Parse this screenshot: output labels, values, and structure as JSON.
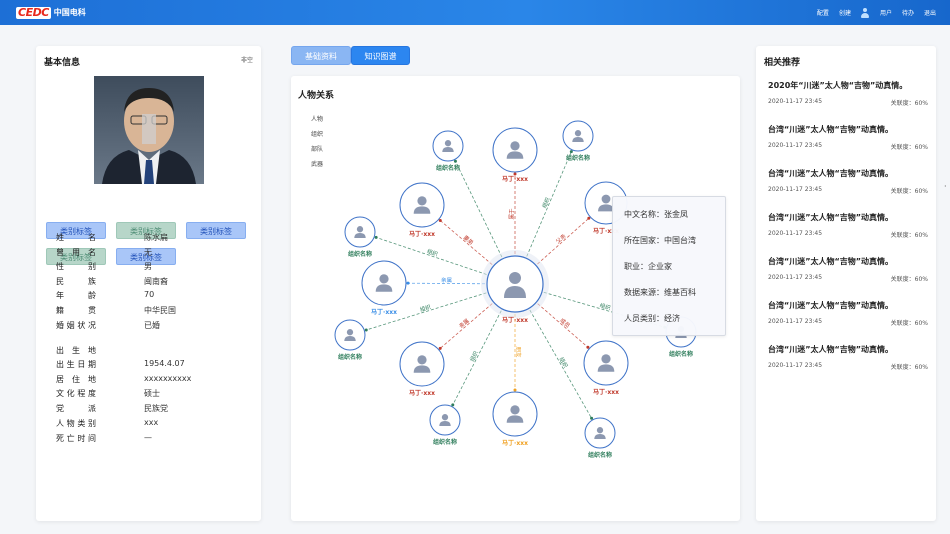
{
  "header": {
    "logo_mark": "CEDC",
    "logo_text": "中国电科",
    "nav": [
      "配置",
      "创建",
      "用户",
      "待办",
      "退出"
    ]
  },
  "left": {
    "title": "基本信息",
    "extra": "非空",
    "tags": [
      {
        "label": "类别标签",
        "style": "blue"
      },
      {
        "label": "类别标签",
        "style": "green"
      },
      {
        "label": "类别标签",
        "style": "blue"
      },
      {
        "label": "类别标签",
        "style": "green"
      },
      {
        "label": "类别标签",
        "style": "blue"
      }
    ],
    "info": [
      {
        "k": "姓名",
        "v": "陈水扁"
      },
      {
        "k": "曾用名",
        "v": "无"
      },
      {
        "k": "性别",
        "v": "男"
      },
      {
        "k": "民族",
        "v": "闽南裔"
      },
      {
        "k": "年龄",
        "v": "70"
      },
      {
        "k": "籍贯",
        "v": "中华民国"
      },
      {
        "k": "婚姻状况",
        "v": "已婚"
      },
      {
        "k": "出生地",
        "v": ""
      },
      {
        "k": "出生日期",
        "v": "1954.4.07"
      },
      {
        "k": "居住地",
        "v": "xxxxxxxxxx"
      },
      {
        "k": "文化程度",
        "v": "硕士"
      },
      {
        "k": "党派",
        "v": "民族党"
      },
      {
        "k": "人物类别",
        "v": "xxx"
      },
      {
        "k": "死亡时间",
        "v": "—"
      }
    ]
  },
  "tabs": [
    "基础资料",
    "知识图谱"
  ],
  "graph": {
    "title": "人物关系",
    "legend": [
      "人物",
      "组织",
      "部队",
      "武器"
    ],
    "center_label": "马丁·xxx",
    "colors": {
      "person": "#c0392b",
      "org": "#2e7d5b",
      "yellow": "#f0a020",
      "blue": "#3a8ee6"
    },
    "nodes": [
      {
        "label": "组织名称",
        "type": "org",
        "edge": ""
      },
      {
        "label": "马丁·xxx",
        "type": "person",
        "edge": "属于"
      },
      {
        "label": "组织名称",
        "type": "org",
        "edge": "组织"
      },
      {
        "label": "马丁·xxx",
        "type": "person",
        "edge": "父亲"
      },
      {
        "label": "马丁·xxx",
        "type": "person",
        "edge": "妻弟"
      },
      {
        "label": "组织名称",
        "type": "org",
        "edge": "组织"
      },
      {
        "label": "马丁·xxx",
        "type": "blue",
        "edge": "亲属"
      },
      {
        "label": "组织名称",
        "type": "org",
        "edge": "组织"
      },
      {
        "label": "马丁·xxx",
        "type": "person",
        "edge": "亲属"
      },
      {
        "label": "组织名称",
        "type": "org",
        "edge": "组织"
      },
      {
        "label": "马丁·xxx",
        "type": "yellow",
        "edge": "朋友"
      },
      {
        "label": "组织名称",
        "type": "org",
        "edge": "组织"
      },
      {
        "label": "马丁·xxx",
        "type": "person",
        "edge": "成员"
      },
      {
        "label": "组织名称",
        "type": "org",
        "edge": "组织"
      },
      {
        "label": "马丁·xxx",
        "type": "blue",
        "edge": "知晓"
      },
      {
        "label": "组织名称",
        "type": "org",
        "edge": "组织"
      },
      {
        "label": "马丁·xxx",
        "type": "person",
        "edge": "相识"
      },
      {
        "label": "组织名称",
        "type": "org",
        "edge": "组织"
      }
    ]
  },
  "tooltip": [
    "中文名称：张金凤",
    "所在国家：中国台湾",
    "职业：企业家",
    "数据来源：维基百科",
    "人员类别：经济"
  ],
  "right": {
    "title": "相关推荐",
    "news": [
      {
        "title": "2020年“川迷”太人物“吉物”动真情。",
        "date": "2020-11-17  23:45",
        "rel": "关联度：60%"
      },
      {
        "title": "台湾“川迷”太人物“吉物”动真情。",
        "date": "2020-11-17  23:45",
        "rel": "关联度：60%"
      },
      {
        "title": "台湾“川迷”太人物“吉物”动真情。",
        "date": "2020-11-17  23:45",
        "rel": "关联度：60%"
      },
      {
        "title": "台湾“川迷”太人物“吉物”动真情。",
        "date": "2020-11-17  23:45",
        "rel": "关联度：60%"
      },
      {
        "title": "台湾“川迷”太人物“吉物”动真情。",
        "date": "2020-11-17  23:45",
        "rel": "关联度：60%"
      },
      {
        "title": "台湾“川迷”太人物“吉物”动真情。",
        "date": "2020-11-17  23:45",
        "rel": "关联度：60%"
      },
      {
        "title": "台湾“川迷”太人物“吉物”动真情。",
        "date": "2020-11-17  23:45",
        "rel": "关联度：60%"
      }
    ]
  }
}
